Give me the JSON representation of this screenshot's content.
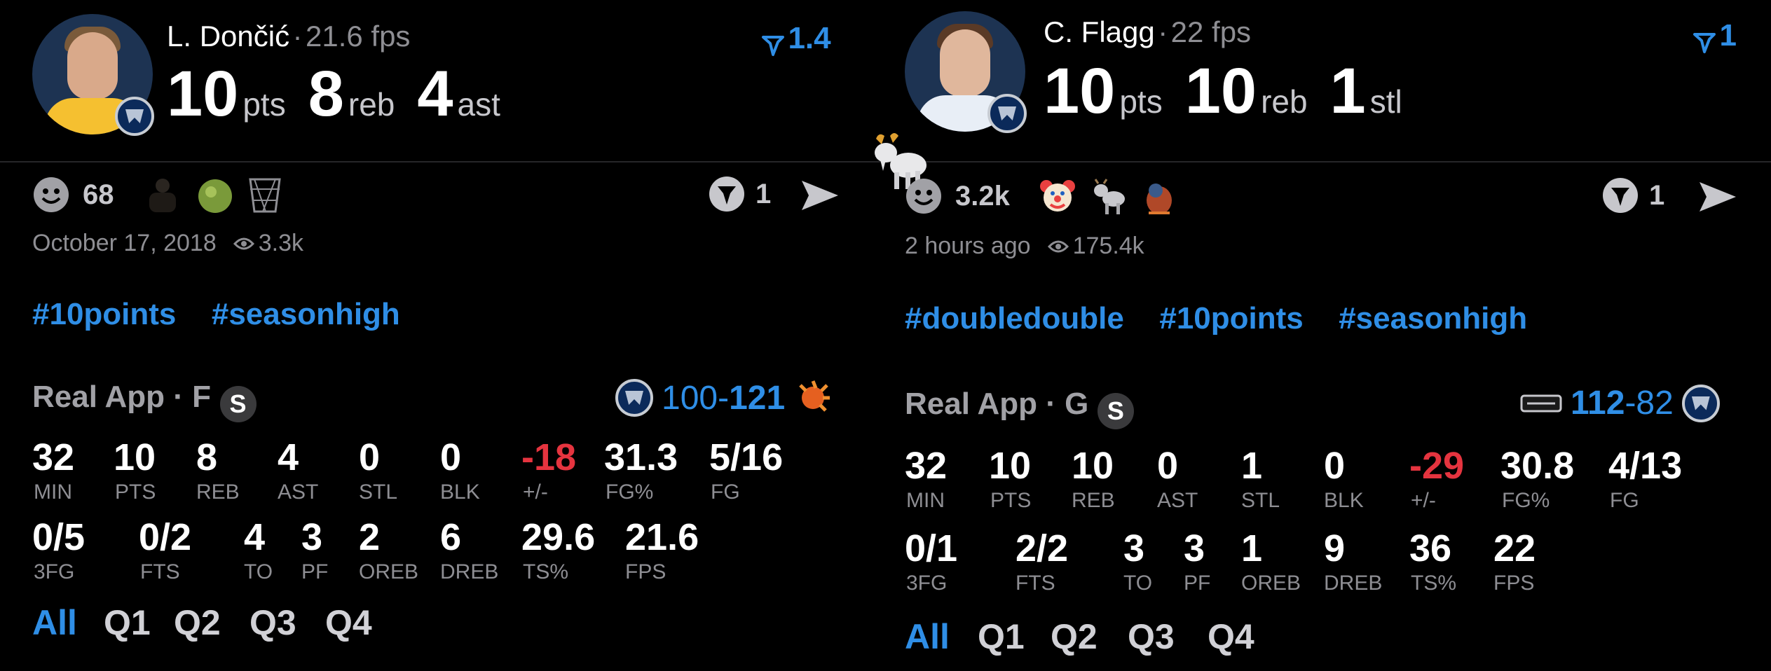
{
  "cards": [
    {
      "player_name": "L. Dončić",
      "name_sep": "·",
      "fps_label": "21.6 fps",
      "headline": [
        {
          "value": "10",
          "unit": "pts"
        },
        {
          "value": "8",
          "unit": "reb"
        },
        {
          "value": "4",
          "unit": "ast"
        }
      ],
      "upvote_value": "1.4",
      "reaction_count": "68",
      "reactions": [
        "person-silhouette",
        "green-apple",
        "basketball-hoop"
      ],
      "comment_count": "1",
      "date": "October 17, 2018",
      "views": "3.3k",
      "hashtags": [
        "#10points",
        "#seasonhigh"
      ],
      "source": "Real App · F",
      "source_badge": "S",
      "score": {
        "left": "100",
        "dash": "-",
        "right": "121",
        "bold_side": "right"
      },
      "opponent_logo": "suns-logo",
      "stat_row1": [
        {
          "v": "32",
          "l": "MIN"
        },
        {
          "v": "10",
          "l": "PTS"
        },
        {
          "v": "8",
          "l": "REB"
        },
        {
          "v": "4",
          "l": "AST"
        },
        {
          "v": "0",
          "l": "STL"
        },
        {
          "v": "0",
          "l": "BLK"
        },
        {
          "v": "-18",
          "l": "+/-"
        },
        {
          "v": "31.3",
          "l": "FG%"
        },
        {
          "v": "5/16",
          "l": "FG"
        }
      ],
      "stat_row2": [
        {
          "v": "0/5",
          "l": "3FG"
        },
        {
          "v": "0/2",
          "l": "FTS"
        },
        {
          "v": "4",
          "l": "TO"
        },
        {
          "v": "3",
          "l": "PF"
        },
        {
          "v": "2",
          "l": "OREB"
        },
        {
          "v": "6",
          "l": "DREB"
        },
        {
          "v": "29.6",
          "l": "TS%"
        },
        {
          "v": "21.6",
          "l": "FPS"
        }
      ],
      "quarters": [
        "All",
        "Q1",
        "Q2",
        "Q3",
        "Q4"
      ],
      "active_quarter": "All"
    },
    {
      "player_name": "C. Flagg",
      "name_sep": "·",
      "fps_label": "22 fps",
      "headline": [
        {
          "value": "10",
          "unit": "pts"
        },
        {
          "value": "10",
          "unit": "reb"
        },
        {
          "value": "1",
          "unit": "stl"
        }
      ],
      "upvote_value": "1",
      "reaction_count": "3.2k",
      "reactions": [
        "clown-face",
        "goat",
        "fire-creature"
      ],
      "comment_count": "1",
      "date": "2 hours ago",
      "views": "175.4k",
      "hashtags": [
        "#doubledouble",
        "#10points",
        "#seasonhigh"
      ],
      "source": "Real App · G",
      "source_badge": "S",
      "score": {
        "left": "112",
        "dash": "-",
        "right": "82",
        "bold_side": "left"
      },
      "opponent_logo": "spurs-logo",
      "stat_row1": [
        {
          "v": "32",
          "l": "MIN"
        },
        {
          "v": "10",
          "l": "PTS"
        },
        {
          "v": "10",
          "l": "REB"
        },
        {
          "v": "0",
          "l": "AST"
        },
        {
          "v": "1",
          "l": "STL"
        },
        {
          "v": "0",
          "l": "BLK"
        },
        {
          "v": "-29",
          "l": "+/-"
        },
        {
          "v": "30.8",
          "l": "FG%"
        },
        {
          "v": "4/13",
          "l": "FG"
        }
      ],
      "stat_row2": [
        {
          "v": "0/1",
          "l": "3FG"
        },
        {
          "v": "2/2",
          "l": "FTS"
        },
        {
          "v": "3",
          "l": "TO"
        },
        {
          "v": "3",
          "l": "PF"
        },
        {
          "v": "1",
          "l": "OREB"
        },
        {
          "v": "9",
          "l": "DREB"
        },
        {
          "v": "36",
          "l": "TS%"
        },
        {
          "v": "22",
          "l": "FPS"
        }
      ],
      "quarters": [
        "All",
        "Q1",
        "Q2",
        "Q3",
        "Q4"
      ],
      "active_quarter": "All"
    }
  ],
  "floating_reaction": "goat-icon",
  "colors": {
    "accent": "#2f8ee6",
    "negative": "#e5343f",
    "muted": "#8e8e93",
    "background": "#000000"
  }
}
